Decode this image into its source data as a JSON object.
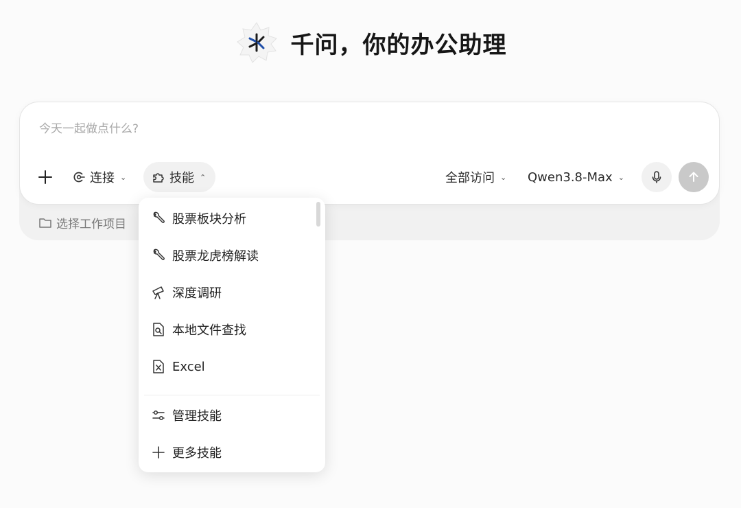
{
  "header": {
    "title": "千问，你的办公助理",
    "logo_icon": "qwen-star-logo"
  },
  "composer": {
    "placeholder": "今天一起做点什么?",
    "add_icon": "plus-icon",
    "connect_label": "连接",
    "skill_label": "技能",
    "access_label": "全部访问",
    "model_label": "Qwen3.8-Max",
    "mic_icon": "microphone-icon",
    "send_icon": "arrow-up-icon"
  },
  "project": {
    "label": "选择工作项目"
  },
  "skills_menu": {
    "items": [
      {
        "label": "股票板块分析",
        "icon": "wrench-icon"
      },
      {
        "label": "股票龙虎榜解读",
        "icon": "wrench-icon"
      },
      {
        "label": "深度调研",
        "icon": "telescope-icon"
      },
      {
        "label": "本地文件查找",
        "icon": "file-search-icon"
      },
      {
        "label": "Excel",
        "icon": "excel-file-icon"
      }
    ],
    "footer": [
      {
        "label": "管理技能",
        "icon": "sliders-icon"
      },
      {
        "label": "更多技能",
        "icon": "plus-icon"
      }
    ]
  },
  "colors": {
    "background": "#fbfbfb",
    "send_disabled": "#c9c9c9",
    "logo_blue": "#1f4ea8"
  }
}
